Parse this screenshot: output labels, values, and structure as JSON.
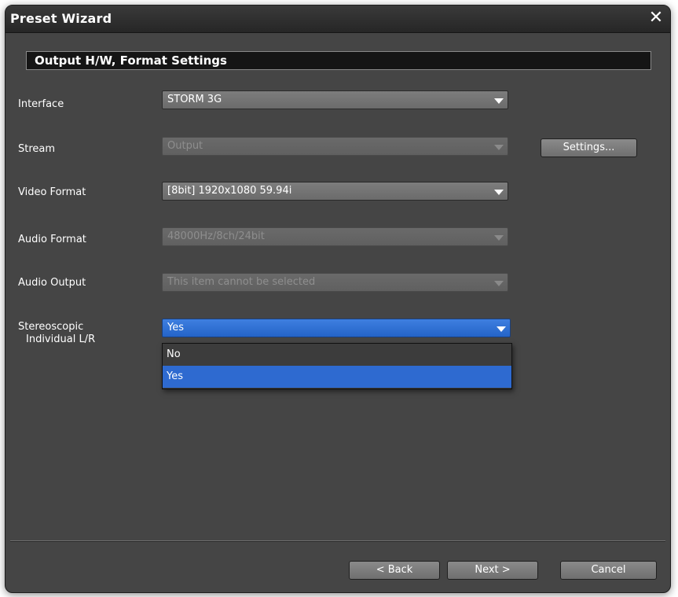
{
  "window": {
    "title": "Preset Wizard",
    "close_glyph": "✕"
  },
  "section": {
    "title": "Output H/W, Format Settings"
  },
  "fields": {
    "interface": {
      "label": "Interface",
      "value": "STORM 3G"
    },
    "stream": {
      "label": "Stream",
      "value": "Output",
      "disabled": true
    },
    "video_format": {
      "label": "Video Format",
      "value": "[8bit] 1920x1080 59.94i"
    },
    "audio_format": {
      "label": "Audio Format",
      "value": "48000Hz/8ch/24bit",
      "disabled": true
    },
    "audio_output": {
      "label": "Audio Output",
      "value": "This item cannot be selected",
      "disabled": true
    },
    "stereoscopic": {
      "label_line1": "Stereoscopic",
      "label_line2": "Individual L/R",
      "value": "Yes",
      "options": [
        "No",
        "Yes"
      ],
      "selected_option": "Yes"
    }
  },
  "buttons": {
    "settings": "Settings...",
    "back": "< Back",
    "next": "Next >",
    "cancel": "Cancel"
  },
  "colors": {
    "window_bg": "#454545",
    "accent_blue": "#2e6ad0"
  }
}
